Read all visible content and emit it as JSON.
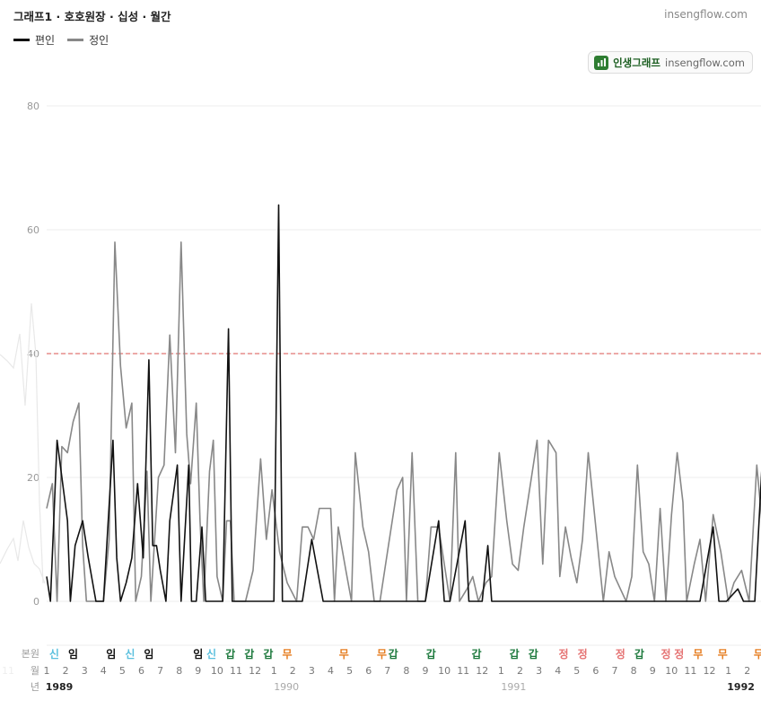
{
  "header": {
    "title": "그래프1 · 호호원장 · 십성 · 월간",
    "site": "insengflow.com"
  },
  "legend": [
    {
      "label": "편인",
      "color": "#111111"
    },
    {
      "label": "정인",
      "color": "#888888"
    }
  ],
  "badge": {
    "brand": "인생그래프",
    "site": "insengflow.com",
    "logo_icon": "chart-icon"
  },
  "chart_data": {
    "type": "line",
    "title": "그래프1 · 호호원장 · 십성 · 월간",
    "ylim": [
      0,
      80
    ],
    "yticks": [
      0,
      20,
      40,
      60,
      80
    ],
    "threshold": {
      "value": 40,
      "color": "#d9534f",
      "style": "dashed"
    },
    "grid": true,
    "legend_position": "top-left",
    "x_start": "1989-01",
    "row_labels": {
      "hidden_top": "11",
      "month": "월",
      "year": "년",
      "bonwon": "본원"
    },
    "x_labels": {
      "months": [
        1,
        2,
        3,
        4,
        5,
        6,
        7,
        8,
        9,
        10,
        11,
        12,
        1,
        2,
        3,
        4,
        5,
        6,
        7,
        8,
        9,
        10,
        11,
        12,
        1,
        2,
        3,
        4,
        5,
        6,
        7,
        8,
        9,
        10,
        11,
        12,
        1,
        2
      ],
      "years": [
        {
          "index": 0,
          "label": "1989",
          "bold": true
        },
        {
          "index": 12,
          "label": "1990",
          "bold": false
        },
        {
          "index": 24,
          "label": "1991",
          "bold": false
        },
        {
          "index": 36,
          "label": "1992",
          "bold": true
        }
      ]
    },
    "bonwon_labels": [
      {
        "x": 0.4,
        "label": "신",
        "color": "#5bc0de"
      },
      {
        "x": 1.4,
        "label": "임",
        "color": "#111111"
      },
      {
        "x": 3.4,
        "label": "임",
        "color": "#111111"
      },
      {
        "x": 4.4,
        "label": "신",
        "color": "#5bc0de"
      },
      {
        "x": 5.4,
        "label": "임",
        "color": "#111111"
      },
      {
        "x": 8.0,
        "label": "임",
        "color": "#111111"
      },
      {
        "x": 8.7,
        "label": "신",
        "color": "#5bc0de"
      },
      {
        "x": 9.7,
        "label": "갑",
        "color": "#1e7a3e"
      },
      {
        "x": 10.7,
        "label": "갑",
        "color": "#1e7a3e"
      },
      {
        "x": 11.7,
        "label": "갑",
        "color": "#1e7a3e"
      },
      {
        "x": 12.7,
        "label": "무",
        "color": "#e67e22"
      },
      {
        "x": 15.7,
        "label": "무",
        "color": "#e67e22"
      },
      {
        "x": 17.7,
        "label": "무",
        "color": "#e67e22"
      },
      {
        "x": 18.3,
        "label": "갑",
        "color": "#1e7a3e"
      },
      {
        "x": 20.3,
        "label": "갑",
        "color": "#1e7a3e"
      },
      {
        "x": 22.7,
        "label": "갑",
        "color": "#1e7a3e"
      },
      {
        "x": 24.7,
        "label": "갑",
        "color": "#1e7a3e"
      },
      {
        "x": 25.7,
        "label": "갑",
        "color": "#1e7a3e"
      },
      {
        "x": 27.3,
        "label": "정",
        "color": "#e57373"
      },
      {
        "x": 28.3,
        "label": "정",
        "color": "#e57373"
      },
      {
        "x": 30.3,
        "label": "정",
        "color": "#e57373"
      },
      {
        "x": 31.3,
        "label": "갑",
        "color": "#1e7a3e"
      },
      {
        "x": 32.7,
        "label": "정",
        "color": "#e57373"
      },
      {
        "x": 33.4,
        "label": "정",
        "color": "#e57373"
      },
      {
        "x": 34.4,
        "label": "무",
        "color": "#e67e22"
      },
      {
        "x": 35.7,
        "label": "무",
        "color": "#e67e22"
      },
      {
        "x": 37.6,
        "label": "무",
        "color": "#e67e22"
      },
      {
        "x": 38.2,
        "label": "정",
        "color": "#e57373"
      }
    ],
    "series": [
      {
        "name": "편인",
        "color": "#111111",
        "points": [
          [
            0,
            4
          ],
          [
            0.2,
            0
          ],
          [
            0.55,
            26
          ],
          [
            1.1,
            13
          ],
          [
            1.25,
            0
          ],
          [
            1.5,
            9
          ],
          [
            1.9,
            13
          ],
          [
            2.2,
            7
          ],
          [
            2.6,
            0
          ],
          [
            3.0,
            0
          ],
          [
            3.5,
            26
          ],
          [
            3.7,
            7
          ],
          [
            3.9,
            0
          ],
          [
            4.2,
            3
          ],
          [
            4.5,
            7
          ],
          [
            4.8,
            19
          ],
          [
            5.1,
            7
          ],
          [
            5.4,
            39
          ],
          [
            5.6,
            9
          ],
          [
            5.8,
            9
          ],
          [
            6.0,
            5
          ],
          [
            6.3,
            0
          ],
          [
            6.5,
            13
          ],
          [
            6.9,
            22
          ],
          [
            7.1,
            0
          ],
          [
            7.5,
            22
          ],
          [
            7.65,
            0
          ],
          [
            7.9,
            0
          ],
          [
            8.2,
            12
          ],
          [
            8.4,
            0
          ],
          [
            9.0,
            0
          ],
          [
            9.3,
            0
          ],
          [
            9.6,
            44
          ],
          [
            9.8,
            0
          ],
          [
            11.0,
            0
          ],
          [
            12.0,
            0
          ],
          [
            12.25,
            64
          ],
          [
            12.45,
            0
          ],
          [
            13.5,
            0
          ],
          [
            14.0,
            10
          ],
          [
            14.3,
            5
          ],
          [
            14.6,
            0
          ],
          [
            16.0,
            0
          ],
          [
            18.0,
            0
          ],
          [
            19.0,
            0
          ],
          [
            20.0,
            0
          ],
          [
            20.7,
            13
          ],
          [
            21.0,
            0
          ],
          [
            21.3,
            0
          ],
          [
            22.1,
            13
          ],
          [
            22.3,
            0
          ],
          [
            23.0,
            0
          ],
          [
            23.3,
            9
          ],
          [
            23.5,
            0
          ],
          [
            25,
            0
          ],
          [
            27,
            0
          ],
          [
            30,
            0
          ],
          [
            33,
            0
          ],
          [
            34.5,
            0
          ],
          [
            35.2,
            12
          ],
          [
            35.5,
            0
          ],
          [
            35.9,
            0
          ],
          [
            36.5,
            2
          ],
          [
            36.8,
            0
          ],
          [
            37.4,
            0
          ],
          [
            38.3,
            52
          ],
          [
            38.55,
            0
          ],
          [
            39.3,
            0
          ],
          [
            39.6,
            2
          ],
          [
            40.0,
            0
          ],
          [
            40.3,
            1
          ],
          [
            40.6,
            0
          ]
        ]
      },
      {
        "name": "정인",
        "color": "#888888",
        "points": [
          [
            0,
            15
          ],
          [
            0.3,
            19
          ],
          [
            0.55,
            0
          ],
          [
            0.8,
            25
          ],
          [
            1.1,
            24
          ],
          [
            1.4,
            29
          ],
          [
            1.7,
            32
          ],
          [
            1.9,
            9
          ],
          [
            2.1,
            0
          ],
          [
            2.5,
            0
          ],
          [
            3.0,
            0
          ],
          [
            3.3,
            10
          ],
          [
            3.6,
            58
          ],
          [
            3.9,
            38
          ],
          [
            4.2,
            28
          ],
          [
            4.5,
            32
          ],
          [
            4.7,
            0
          ],
          [
            5.0,
            4
          ],
          [
            5.3,
            21
          ],
          [
            5.5,
            0
          ],
          [
            5.9,
            20
          ],
          [
            6.2,
            22
          ],
          [
            6.5,
            43
          ],
          [
            6.8,
            24
          ],
          [
            7.1,
            58
          ],
          [
            7.4,
            27
          ],
          [
            7.6,
            19
          ],
          [
            7.9,
            32
          ],
          [
            8.1,
            13
          ],
          [
            8.3,
            0
          ],
          [
            8.6,
            21
          ],
          [
            8.8,
            26
          ],
          [
            9.0,
            4
          ],
          [
            9.3,
            0
          ],
          [
            9.5,
            13
          ],
          [
            9.7,
            13
          ],
          [
            9.9,
            0
          ],
          [
            10.1,
            0
          ],
          [
            10.5,
            0
          ],
          [
            10.9,
            5
          ],
          [
            11.3,
            23
          ],
          [
            11.6,
            10
          ],
          [
            11.9,
            18
          ],
          [
            12.3,
            8
          ],
          [
            12.7,
            3
          ],
          [
            13.2,
            0
          ],
          [
            13.5,
            12
          ],
          [
            13.8,
            12
          ],
          [
            14.1,
            10
          ],
          [
            14.4,
            15
          ],
          [
            14.7,
            15
          ],
          [
            15.0,
            15
          ],
          [
            15.2,
            0
          ],
          [
            15.4,
            12
          ],
          [
            15.8,
            5
          ],
          [
            16.1,
            0
          ],
          [
            16.3,
            24
          ],
          [
            16.7,
            12
          ],
          [
            17.0,
            8
          ],
          [
            17.3,
            0
          ],
          [
            17.6,
            0
          ],
          [
            18.0,
            8
          ],
          [
            18.5,
            18
          ],
          [
            18.8,
            20
          ],
          [
            19.0,
            0
          ],
          [
            19.3,
            24
          ],
          [
            19.6,
            0
          ],
          [
            20.0,
            0
          ],
          [
            20.3,
            12
          ],
          [
            20.7,
            12
          ],
          [
            21.0,
            6
          ],
          [
            21.3,
            0
          ],
          [
            21.6,
            24
          ],
          [
            21.8,
            0
          ],
          [
            22.2,
            2
          ],
          [
            22.5,
            4
          ],
          [
            22.8,
            0
          ],
          [
            23.2,
            3
          ],
          [
            23.5,
            4
          ],
          [
            23.9,
            24
          ],
          [
            24.3,
            13
          ],
          [
            24.6,
            6
          ],
          [
            24.9,
            5
          ],
          [
            25.2,
            12
          ],
          [
            25.6,
            20
          ],
          [
            25.9,
            26
          ],
          [
            26.2,
            6
          ],
          [
            26.5,
            26
          ],
          [
            26.9,
            24
          ],
          [
            27.1,
            4
          ],
          [
            27.4,
            12
          ],
          [
            27.7,
            7
          ],
          [
            28.0,
            3
          ],
          [
            28.3,
            10
          ],
          [
            28.6,
            24
          ],
          [
            28.9,
            15
          ],
          [
            29.2,
            6
          ],
          [
            29.4,
            0
          ],
          [
            29.7,
            8
          ],
          [
            30.0,
            4
          ],
          [
            30.3,
            2
          ],
          [
            30.6,
            0
          ],
          [
            30.9,
            4
          ],
          [
            31.2,
            22
          ],
          [
            31.5,
            8
          ],
          [
            31.8,
            6
          ],
          [
            32.1,
            0
          ],
          [
            32.4,
            15
          ],
          [
            32.7,
            0
          ],
          [
            33.0,
            14
          ],
          [
            33.3,
            24
          ],
          [
            33.6,
            16
          ],
          [
            33.8,
            0
          ],
          [
            34.2,
            6
          ],
          [
            34.5,
            10
          ],
          [
            34.8,
            0
          ],
          [
            35.2,
            14
          ],
          [
            35.6,
            8
          ],
          [
            36.0,
            0
          ],
          [
            36.3,
            3
          ],
          [
            36.7,
            5
          ],
          [
            37.1,
            0
          ],
          [
            37.5,
            22
          ],
          [
            37.8,
            12
          ],
          [
            38.2,
            0
          ],
          [
            38.6,
            15
          ],
          [
            38.9,
            0
          ],
          [
            39.2,
            24
          ],
          [
            39.5,
            16
          ],
          [
            39.8,
            0
          ],
          [
            40.1,
            10
          ],
          [
            40.4,
            0
          ],
          [
            40.7,
            2
          ]
        ]
      }
    ]
  }
}
